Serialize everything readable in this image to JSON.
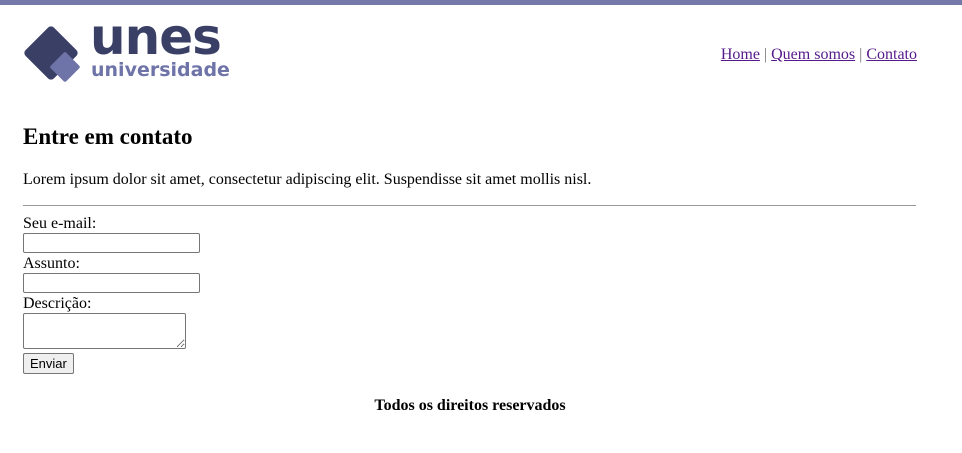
{
  "header": {
    "logo": {
      "name": "unes",
      "subtitle": "universidade"
    },
    "nav": [
      {
        "label": "Home"
      },
      {
        "label": "Quem somos"
      },
      {
        "label": "Contato"
      }
    ],
    "separator": "|"
  },
  "main": {
    "title": "Entre em contato",
    "intro": "Lorem ipsum dolor sit amet, consectetur adipiscing elit. Suspendisse sit amet mollis nisl.",
    "form": {
      "email_label": "Seu e-mail:",
      "email_value": "",
      "subject_label": "Assunto:",
      "subject_value": "",
      "description_label": "Descrição:",
      "description_value": "",
      "submit_label": "Enviar"
    }
  },
  "footer": {
    "text": "Todos os direitos reservados"
  },
  "colors": {
    "top_bar": "#7579aa",
    "logo_dark": "#3a3f66",
    "logo_light": "#6f74a8",
    "link_visited": "#551a8b"
  }
}
